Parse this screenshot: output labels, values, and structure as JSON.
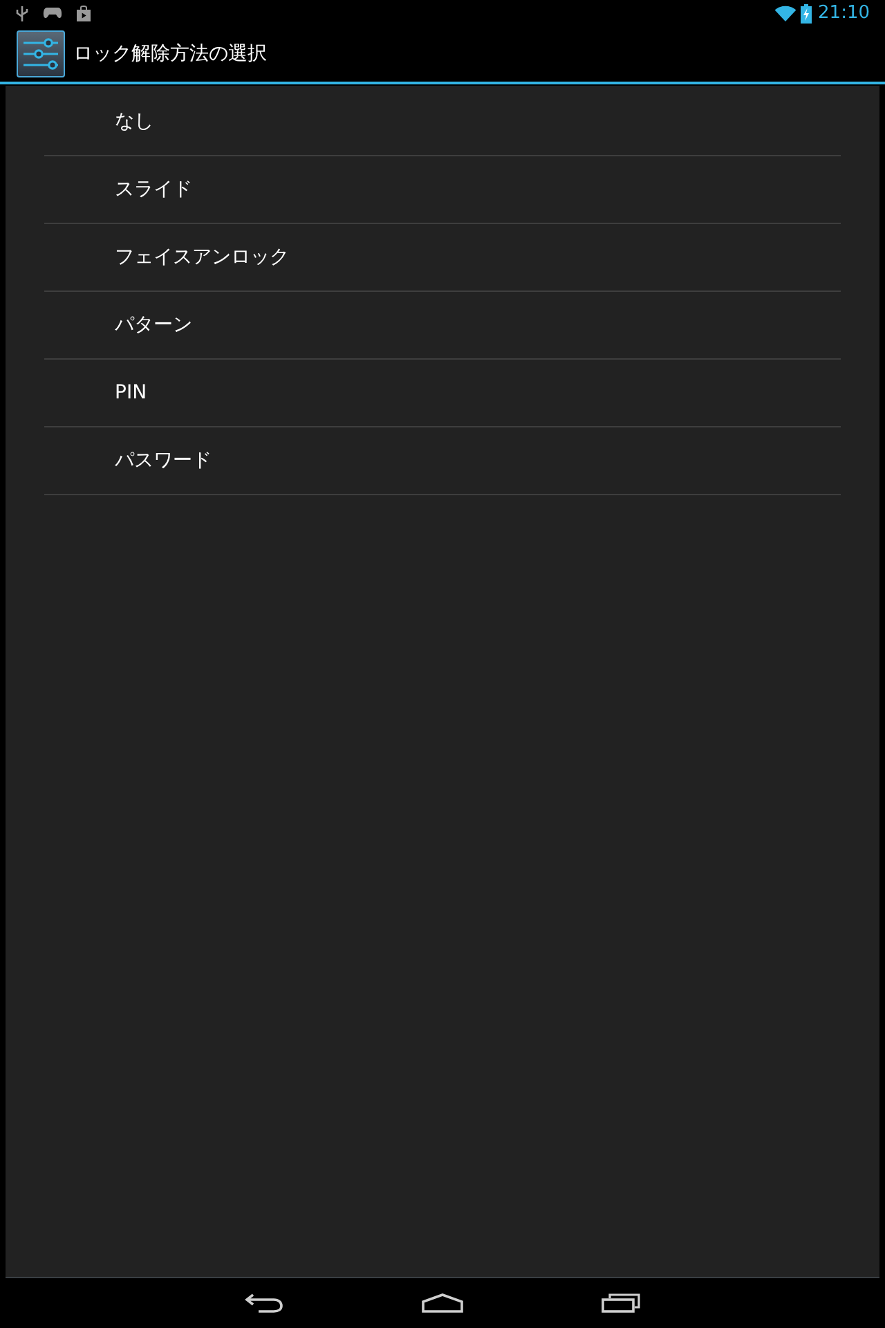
{
  "status_bar": {
    "time": "21:10"
  },
  "action_bar": {
    "title": "ロック解除方法の選択"
  },
  "options": [
    {
      "label": "なし"
    },
    {
      "label": "スライド"
    },
    {
      "label": "フェイスアンロック"
    },
    {
      "label": "パターン"
    },
    {
      "label": "PIN"
    },
    {
      "label": "パスワード"
    }
  ]
}
